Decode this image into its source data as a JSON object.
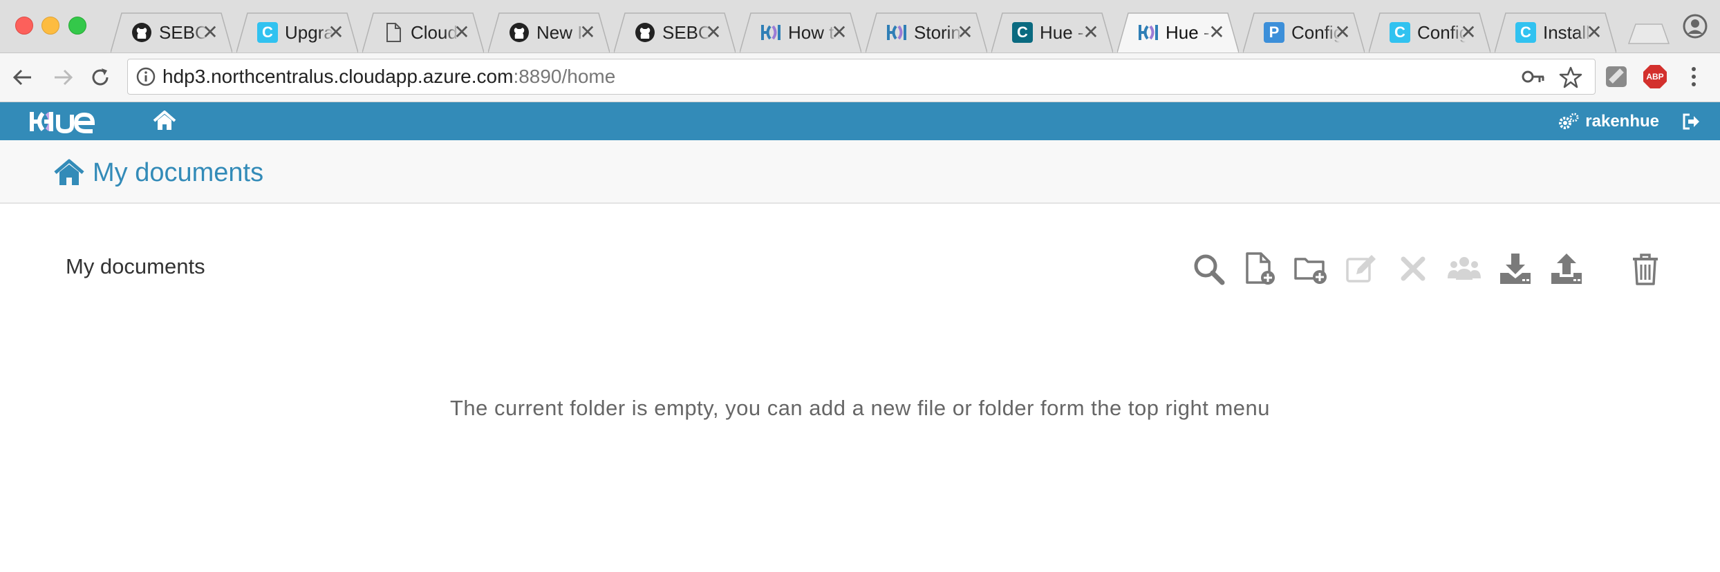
{
  "browser": {
    "tabs": [
      {
        "title": "SEBC/l",
        "icon": "github-icon",
        "active": false
      },
      {
        "title": "Upgrad",
        "icon": "cloudera-icon",
        "active": false
      },
      {
        "title": "Cloude",
        "icon": "document-icon",
        "active": false
      },
      {
        "title": "New Is",
        "icon": "github-icon",
        "active": false
      },
      {
        "title": "SEBC/l",
        "icon": "github-icon",
        "active": false
      },
      {
        "title": "How to",
        "icon": "hue-icon",
        "active": false
      },
      {
        "title": "Storing",
        "icon": "hue-icon",
        "active": false
      },
      {
        "title": "Hue - (",
        "icon": "cloudera-dark-icon",
        "active": false
      },
      {
        "title": "Hue - \\",
        "icon": "hue-icon",
        "active": true
      },
      {
        "title": "Config",
        "icon": "p-icon",
        "active": false
      },
      {
        "title": "Config",
        "icon": "cloudera-icon",
        "active": false
      },
      {
        "title": "Installi",
        "icon": "cloudera-icon",
        "active": false
      }
    ],
    "url_host": "hdp3.northcentralus.cloudapp.azure.com",
    "url_rest": ":8890/home",
    "extension_abp": "ABP"
  },
  "hue": {
    "user": "rakenhue",
    "page_title": "My documents",
    "section_title": "My documents",
    "empty_message": "The current folder is empty, you can add a new file or folder form the top right menu",
    "actions": [
      {
        "name": "search-action-icon",
        "enabled": true
      },
      {
        "name": "new-document-icon",
        "enabled": true
      },
      {
        "name": "new-folder-icon",
        "enabled": true
      },
      {
        "name": "edit-icon",
        "enabled": false
      },
      {
        "name": "delete-x-icon",
        "enabled": false
      },
      {
        "name": "share-users-icon",
        "enabled": false
      },
      {
        "name": "download-icon",
        "enabled": true
      },
      {
        "name": "upload-icon",
        "enabled": true
      },
      {
        "name": "trash-icon",
        "enabled": true
      }
    ]
  },
  "colors": {
    "hue_blue": "#338bb8",
    "action_enabled": "#7a7a7a",
    "action_disabled": "#d4d4d4"
  }
}
